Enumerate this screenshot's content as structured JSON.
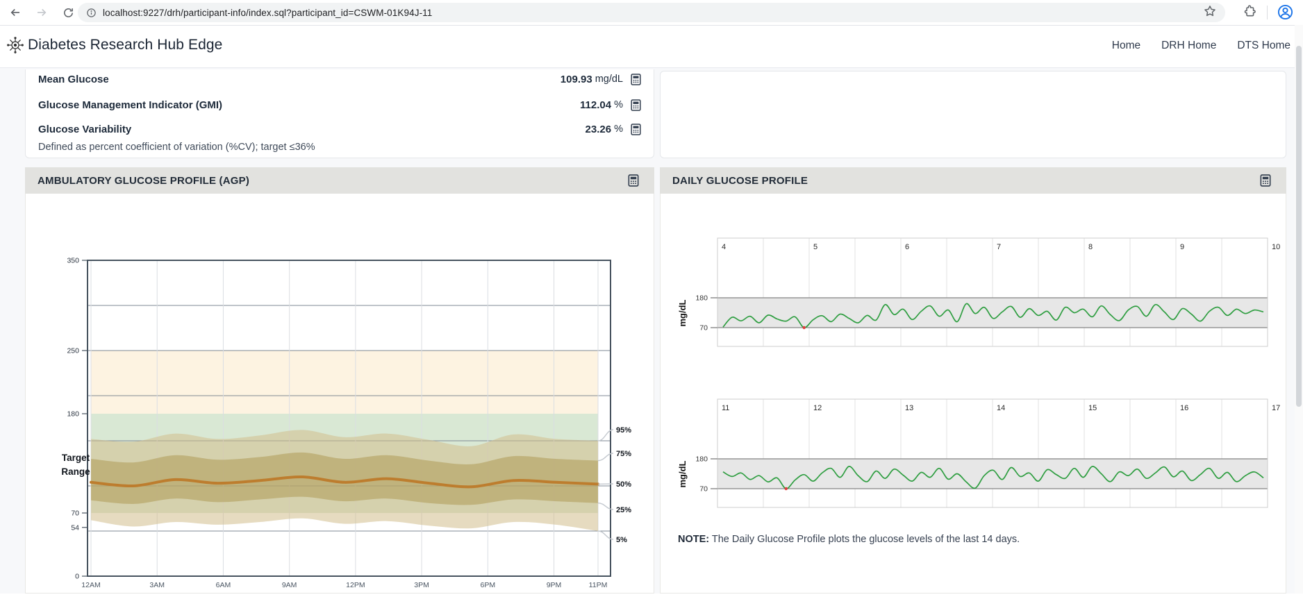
{
  "browser": {
    "url": "localhost:9227/drh/participant-info/index.sql?participant_id=CSWM-01K94J-11"
  },
  "header": {
    "title": "Diabetes Research Hub Edge",
    "nav": [
      {
        "label": "Home"
      },
      {
        "label": "DRH Home"
      },
      {
        "label": "DTS Home"
      }
    ]
  },
  "metrics": {
    "rows": [
      {
        "label": "Mean Glucose",
        "value": "109.93",
        "unit": "mg/dL"
      },
      {
        "label": "Glucose Management Indicator (GMI)",
        "value": "112.04",
        "unit": "%"
      },
      {
        "label": "Glucose Variability",
        "value": "23.26",
        "unit": "%"
      }
    ],
    "footnote": "Defined as percent coefficient of variation (%CV); target ≤36%"
  },
  "agp": {
    "title": "AMBULATORY GLUCOSE PROFILE (AGP)"
  },
  "daily": {
    "title": "DAILY GLUCOSE PROFILE",
    "note_label": "NOTE:",
    "note_text": "The Daily Glucose Profile plots the glucose levels of the last 14 days."
  },
  "chart_data": [
    {
      "id": "agp",
      "type": "area",
      "title": "Ambulatory Glucose Profile (AGP)",
      "ylim": [
        0,
        350
      ],
      "yticks": [
        350,
        250,
        180,
        70,
        54,
        0
      ],
      "gridlines_mgdl": [
        300,
        250,
        200,
        150,
        100,
        50
      ],
      "xticks": [
        {
          "hour": 0,
          "label": "12AM"
        },
        {
          "hour": 3,
          "label": "3AM"
        },
        {
          "hour": 6,
          "label": "6AM"
        },
        {
          "hour": 9,
          "label": "9AM"
        },
        {
          "hour": 12,
          "label": "12PM"
        },
        {
          "hour": 15,
          "label": "3PM"
        },
        {
          "hour": 18,
          "label": "6PM"
        },
        {
          "hour": 21,
          "label": "9PM"
        },
        {
          "hour": 23,
          "label": "11PM"
        }
      ],
      "x_hours": [
        0,
        2,
        4,
        6,
        8,
        10,
        12,
        14,
        16,
        18,
        20,
        22,
        24
      ],
      "series": [
        {
          "name": "p95",
          "values": [
            152,
            149,
            158,
            152,
            156,
            162,
            154,
            158,
            151,
            144,
            157,
            152,
            150
          ]
        },
        {
          "name": "p75",
          "values": [
            130,
            126,
            134,
            129,
            132,
            137,
            130,
            134,
            128,
            124,
            133,
            130,
            128
          ]
        },
        {
          "name": "median",
          "values": [
            104,
            100,
            107,
            103,
            106,
            110,
            104,
            108,
            103,
            99,
            106,
            104,
            102
          ]
        },
        {
          "name": "p25",
          "values": [
            84,
            80,
            86,
            82,
            85,
            88,
            83,
            86,
            81,
            79,
            85,
            83,
            81
          ]
        },
        {
          "name": "p5",
          "values": [
            62,
            55,
            60,
            57,
            60,
            64,
            58,
            61,
            56,
            53,
            60,
            57,
            50
          ]
        }
      ],
      "percentile_labels": [
        "95%",
        "75%",
        "50%",
        "25%",
        "5%"
      ],
      "target_label": "Target Range",
      "target_range": [
        70,
        180
      ],
      "high_range": [
        180,
        250
      ],
      "colors": {
        "median": "#bd7d2e",
        "band_outer": "rgba(209,189,140,0.55)",
        "band_inner": "rgba(175,155,86,0.55)",
        "target_band": "#d9e8d4",
        "high_band": "#fdf3e1",
        "box": "#46525e",
        "hgrid": "#7f8894",
        "vgrid": "#dadde2"
      }
    },
    {
      "id": "daily-strip-1",
      "type": "line",
      "ylabel": "mg/dL",
      "yticks": [
        180,
        70
      ],
      "target_band": [
        70,
        180
      ],
      "ylim": [
        0,
        400
      ],
      "day_labels": [
        "4",
        "5",
        "6",
        "7",
        "8",
        "9",
        "10"
      ],
      "line_color": "#2f9e41",
      "low_marker_color": "#e23b3b",
      "low_marker_indices": [
        9
      ],
      "values": [
        72,
        108,
        95,
        112,
        88,
        116,
        102,
        94,
        110,
        70,
        99,
        114,
        92,
        120,
        104,
        88,
        115,
        98,
        155,
        118,
        138,
        100,
        130,
        150,
        112,
        135,
        92,
        158,
        122,
        145,
        104,
        128,
        148,
        108,
        140,
        115,
        130,
        98,
        145,
        125,
        138,
        110,
        150,
        118,
        96,
        135,
        148,
        112,
        155,
        128,
        100,
        140,
        120,
        94,
        130,
        145,
        115,
        138,
        122,
        135,
        128
      ]
    },
    {
      "id": "daily-strip-2",
      "type": "line",
      "ylabel": "mg/dL",
      "yticks": [
        180,
        70
      ],
      "target_band": [
        70,
        180
      ],
      "ylim": [
        0,
        400
      ],
      "day_labels": [
        "11",
        "12",
        "13",
        "14",
        "15",
        "16",
        "17"
      ],
      "line_color": "#2f9e41",
      "low_marker_color": "#e23b3b",
      "low_marker_indices": [
        7
      ],
      "values": [
        132,
        115,
        128,
        104,
        118,
        95,
        110,
        70,
        102,
        122,
        98,
        128,
        145,
        112,
        152,
        118,
        96,
        135,
        108,
        142,
        120,
        98,
        130,
        112,
        145,
        105,
        125,
        95,
        72,
        118,
        138,
        104,
        148,
        115,
        128,
        98,
        140,
        122,
        108,
        145,
        112,
        152,
        125,
        96,
        132,
        118,
        142,
        108,
        128,
        150,
        114,
        135,
        100,
        122,
        145,
        108,
        130,
        96,
        118,
        132,
        110
      ]
    }
  ]
}
